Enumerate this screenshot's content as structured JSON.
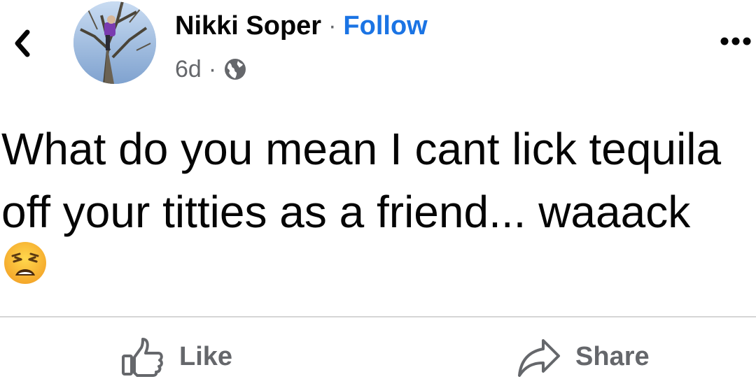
{
  "header": {
    "back_icon": "chevron-left-icon",
    "author_name": "Nikki Soper",
    "separator": "·",
    "follow_label": "Follow",
    "post_age": "6d",
    "meta_separator": "·",
    "privacy_icon": "globe-icon",
    "more_icon": "more-horizontal-icon"
  },
  "post": {
    "text": "What do you mean I cant lick tequila off your titties as a friend... waaack",
    "emoji": "weary-face-emoji"
  },
  "actions": {
    "like_label": "Like",
    "like_icon": "thumbs-up-icon",
    "share_label": "Share",
    "share_icon": "share-arrow-icon"
  },
  "colors": {
    "follow": "#1b74e4",
    "secondary_text": "#65676b",
    "primary_text": "#050505",
    "divider": "#d6d6d6"
  }
}
